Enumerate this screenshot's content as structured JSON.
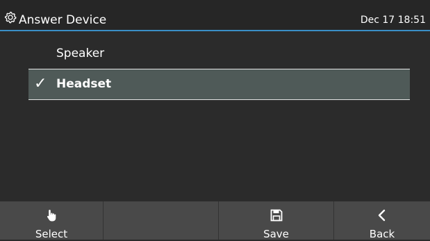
{
  "header": {
    "icon": "gear-icon",
    "title": "Answer Device",
    "datetime": "Dec 17 18:51"
  },
  "list": {
    "items": [
      {
        "label": "Speaker",
        "selected": false
      },
      {
        "label": "Headset",
        "selected": true,
        "checkmark": "✓"
      }
    ]
  },
  "softkeys": [
    {
      "label": "Select",
      "icon": "hand-pointer-icon"
    },
    {
      "label": "",
      "icon": ""
    },
    {
      "label": "Save",
      "icon": "floppy-disk-icon"
    },
    {
      "label": "Back",
      "icon": "chevron-left-icon"
    }
  ],
  "colors": {
    "background": "#2b2b2b",
    "header_accent": "#3a8fc7",
    "selected_row": "#4f5a58",
    "softkey_bar": "#494949"
  }
}
